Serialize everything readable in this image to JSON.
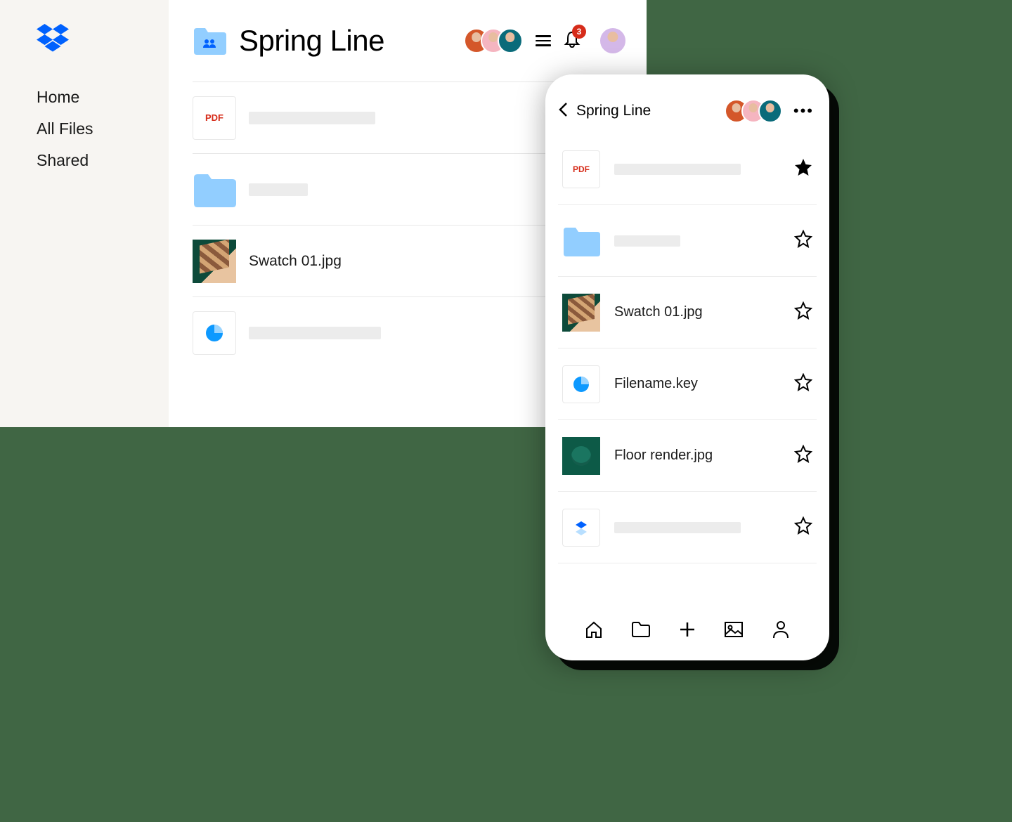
{
  "sidebar": {
    "items": [
      {
        "label": "Home"
      },
      {
        "label": "All Files"
      },
      {
        "label": "Shared"
      }
    ]
  },
  "header": {
    "title": "Spring Line",
    "notification_count": "3"
  },
  "colors": {
    "avatar1": "#d4572a",
    "avatar2": "#f5b5c0",
    "avatar3": "#0a6b7a",
    "avatar_blonde": "#d4b8e8",
    "avatar_yellow": "#f0c040",
    "avatar_teal": "#0a6b7a",
    "avatar_me": "#d4b8e8"
  },
  "files": [
    {
      "type": "pdf",
      "label": "PDF",
      "name_placeholder": true,
      "avatars": [
        "blonde",
        "yellow",
        "teal"
      ]
    },
    {
      "type": "folder",
      "name_placeholder": true,
      "avatars": [
        "me"
      ]
    },
    {
      "type": "image",
      "name": "Swatch 01.jpg",
      "avatars": []
    },
    {
      "type": "chart",
      "name_placeholder": true,
      "avatars": [
        "me"
      ]
    }
  ],
  "mobile": {
    "title": "Spring Line",
    "files": [
      {
        "type": "pdf",
        "label": "PDF",
        "name_placeholder": true,
        "starred": true
      },
      {
        "type": "folder",
        "name_placeholder": true,
        "starred": false
      },
      {
        "type": "image",
        "name": "Swatch 01.jpg",
        "starred": false
      },
      {
        "type": "chart",
        "name": "Filename.key",
        "starred": false
      },
      {
        "type": "image2",
        "name": "Floor render.jpg",
        "starred": false
      },
      {
        "type": "dropbox",
        "name_placeholder": true,
        "starred": false
      }
    ]
  }
}
